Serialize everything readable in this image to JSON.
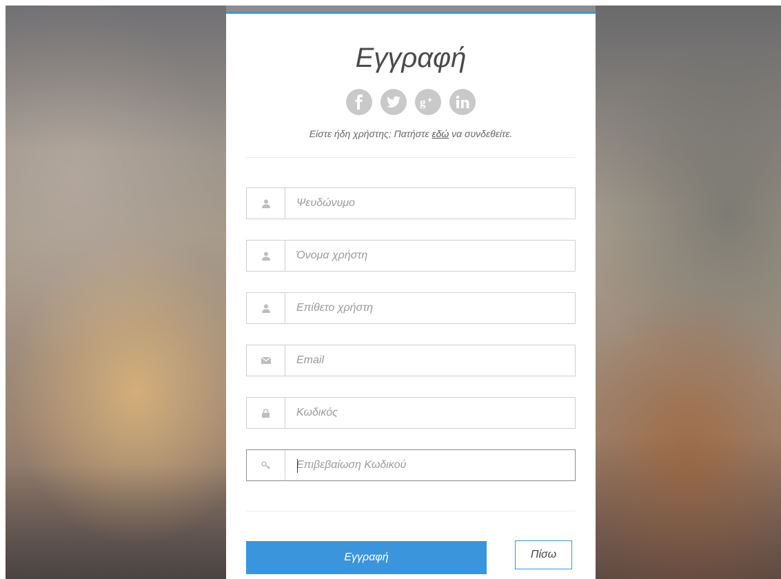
{
  "form": {
    "title": "Εγγραφή",
    "login_prefix": "Είστε ήδη χρήστης; Πατήστε ",
    "login_link": "εδώ",
    "login_suffix": " να συνδεθείτε.",
    "socials": [
      {
        "name": "facebook",
        "icon": "facebook-icon"
      },
      {
        "name": "twitter",
        "icon": "twitter-icon"
      },
      {
        "name": "google-plus",
        "icon": "google-plus-icon"
      },
      {
        "name": "linkedin",
        "icon": "linkedin-icon"
      }
    ],
    "fields": [
      {
        "placeholder": "Ψευδώνυμο",
        "icon": "user-icon",
        "value": ""
      },
      {
        "placeholder": "Όνομα χρήστη",
        "icon": "user-icon",
        "value": ""
      },
      {
        "placeholder": "Επίθετο χρήστη",
        "icon": "user-icon",
        "value": ""
      },
      {
        "placeholder": "Email",
        "icon": "envelope-icon",
        "value": ""
      },
      {
        "placeholder": "Κωδικός",
        "icon": "lock-icon",
        "value": ""
      },
      {
        "placeholder": "Επιβεβαίωση Κωδικού",
        "icon": "key-icon",
        "value": ""
      }
    ],
    "submit_label": "Εγγραφή",
    "back_label": "Πίσω"
  },
  "colors": {
    "accent": "#3a95dc",
    "icon_gray": "#c9c9c9"
  }
}
